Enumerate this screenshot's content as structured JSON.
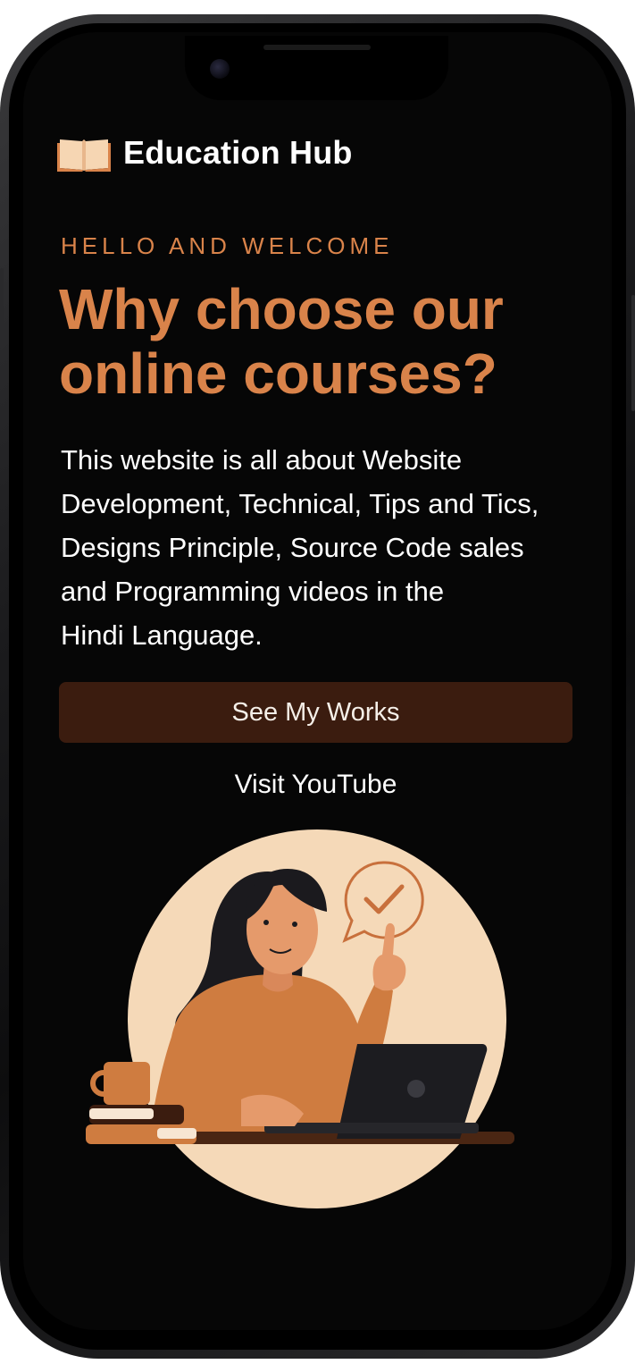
{
  "header": {
    "brand_name": "Education Hub",
    "brand_icon": "open-book-icon"
  },
  "hero": {
    "eyebrow": "HELLO AND WELCOME",
    "headline_line1": "Why choose our",
    "headline_line2": "online courses?",
    "description_lines": [
      "This website is all about Website",
      "Development, Technical, Tips and Tics,",
      "Designs Principle, Source Code sales",
      "and Programming videos in the",
      "Hindi Language."
    ],
    "primary_button_label": "See My Works",
    "secondary_link_label": "Visit YouTube"
  },
  "colors": {
    "accent": "#d9834a",
    "background": "#060606",
    "button_bg": "#3b1c0f",
    "illustration_circle": "#f5d9b8"
  }
}
